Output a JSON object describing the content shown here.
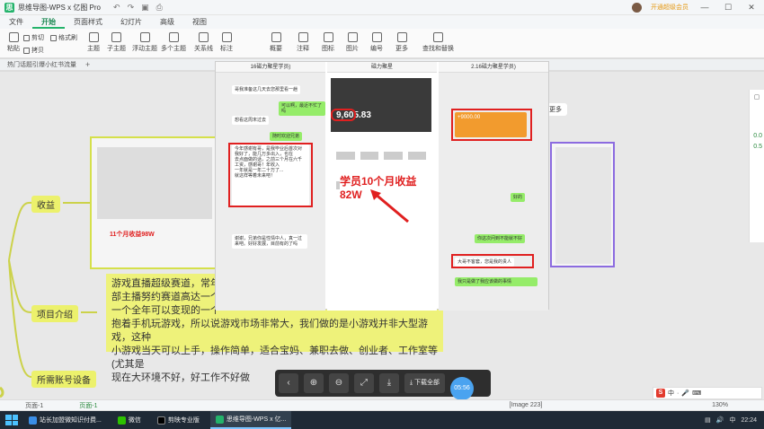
{
  "window": {
    "title": "思维导图-WPS x 亿图 Pro",
    "vip_label": "开通超级会员",
    "controls": [
      "—",
      "☐",
      "✕"
    ]
  },
  "menu": [
    "文件",
    "开始",
    "页面样式",
    "幻灯片",
    "高级",
    "视图"
  ],
  "ribbon": {
    "paste": "粘贴",
    "cut": "剪切",
    "copy": "拷贝",
    "format_brush": "格式刷",
    "topic": "主题",
    "subtopic": "子主题",
    "float_topic": "浮动主题",
    "multi_topic": "多个主题",
    "relation": "关系线",
    "label": "标注",
    "summary": "概要",
    "boundary": "外框",
    "comment": "注释",
    "icon": "图标",
    "picture": "图片",
    "numbering": "编号",
    "more": "更多",
    "find_replace": "查找和替换"
  },
  "doc_tab": "热门话题引爆小红书流量",
  "mindmap": {
    "node_income": "收益",
    "node_intro": "项目介绍",
    "node_devices": "所需账号设备",
    "intro_text": "游戏直播超级赛道，常年能\n部主播努约赛道高达一个亿—\n一个全年可以变现的一个\n抱着手机玩游戏，所以说游戏市场非常大，我们做的是小游戏并非大型游戏，这种\n小游戏当天可以上手，操作简单，适合宝妈、兼职去做、创业者、工作室等(尤其是\n现在大环境不好，好工作不好做",
    "left_img_caption": "11个月收益98W",
    "side_labels": [
      "更多"
    ],
    "zoom_value_1": "0.0",
    "zoom_value_2": "0.5"
  },
  "viewer": {
    "phone1_header": "16磁力聚星学员)",
    "phone2_header": "磁力聚星",
    "phone3_header": "2.16磁力聚星学员)",
    "balance": "9,605.83",
    "earn_caption": "学员10个月收益82W",
    "p1_bubbles": [
      "哥我准备这几天去您那里看一趟",
      "可以啊，最近不忙了吗",
      "想看这周末过去",
      "随时欢迎兄弟"
    ],
    "p1_long": "今年感谢有哥，是我毕业后首次对\n我好了，能几万多出入，也在\n去点面做的话，之前三个月在六千\n工资，感谢哥！年收入\n一年就是一年二十万了...\n就这样等着未来吧！",
    "p1_reply": "谢谢，兄弟你是性情中人，真一过来吧。好好发展，目前有的了吗",
    "p3_bubbles": [
      "好的",
      "你这次问到不能就不好",
      "大哥不客套，您是我的贵人",
      "我只是做了我应该做的事情"
    ],
    "p3_orange": "+9000.00",
    "toolbar_download": "下载全部",
    "time_badge": "05:56"
  },
  "status": {
    "page_label": "页面-1",
    "page_tab": "页面-1",
    "image_counter": "[Image 223]",
    "zoom": "130%"
  },
  "taskbar": {
    "items": [
      "站长加盟微知识付费...",
      "微信",
      "剪映专业版",
      "思维导图-WPS x 亿..."
    ],
    "time": "22:24",
    "lang": "中"
  },
  "colors": {
    "mindmap_node": "#ecf16c",
    "accent": "#24b36b",
    "highlight_red": "#e02020"
  }
}
